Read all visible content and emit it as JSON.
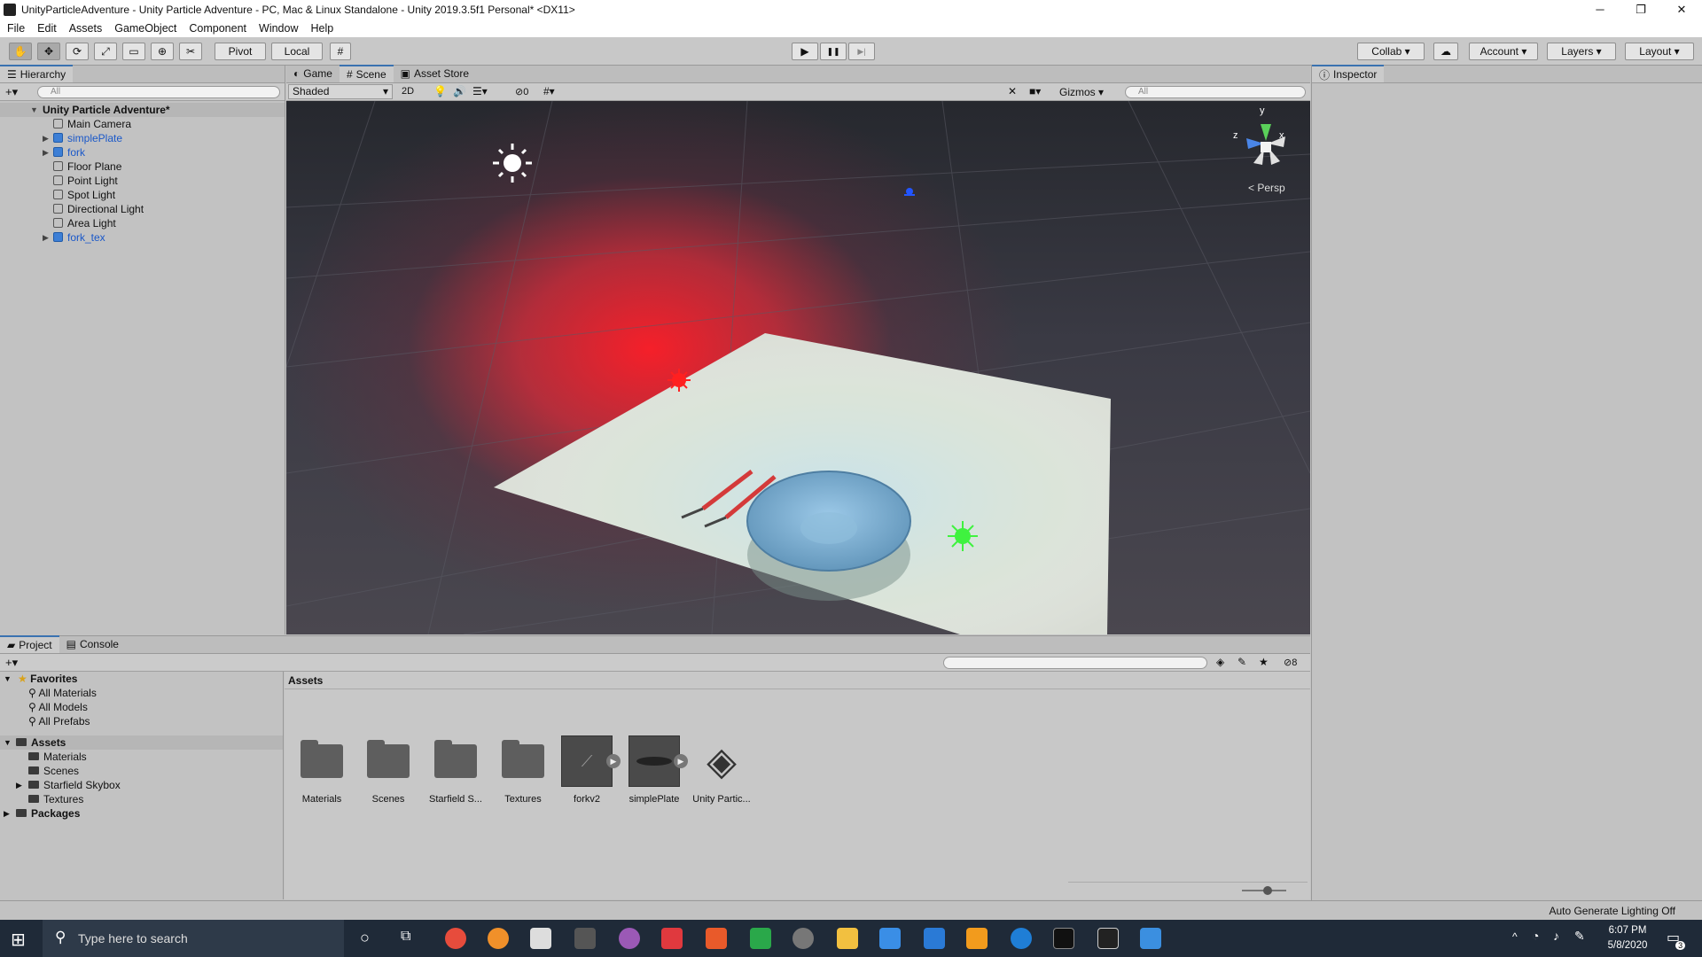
{
  "window": {
    "title": "UnityParticleAdventure - Unity Particle Adventure - PC, Mac & Linux Standalone - Unity 2019.3.5f1 Personal* <DX11>",
    "min": "─",
    "restore": "❐",
    "close": "✕"
  },
  "menu": [
    "File",
    "Edit",
    "Assets",
    "GameObject",
    "Component",
    "Window",
    "Help"
  ],
  "toolbar": {
    "pivot": "Pivot",
    "local": "Local",
    "collab": "Collab ▾",
    "account": "Account",
    "layers": "Layers",
    "layout": "Layout",
    "play": "▶",
    "pause": "❚❚",
    "step": "▶|"
  },
  "hierarchy": {
    "tab": "Hierarchy",
    "search_placeholder": "All",
    "scene": "Unity Particle Adventure*",
    "items": [
      {
        "label": "Main Camera",
        "prefab": false,
        "expandable": false
      },
      {
        "label": "simplePlate",
        "prefab": true,
        "expandable": true
      },
      {
        "label": "fork",
        "prefab": true,
        "expandable": true
      },
      {
        "label": "Floor Plane",
        "prefab": false,
        "expandable": false
      },
      {
        "label": "Point Light",
        "prefab": false,
        "expandable": false
      },
      {
        "label": "Spot Light",
        "prefab": false,
        "expandable": false
      },
      {
        "label": "Directional Light",
        "prefab": false,
        "expandable": false
      },
      {
        "label": "Area Light",
        "prefab": false,
        "expandable": false
      },
      {
        "label": "fork_tex",
        "prefab": true,
        "expandable": true
      }
    ]
  },
  "scene": {
    "tabs": [
      "Game",
      "Scene",
      "Asset Store"
    ],
    "shading": "Shaded",
    "mode2d": "2D",
    "hidden_count": "0",
    "gizmos": "Gizmos",
    "search_placeholder": "All",
    "persp": "Persp",
    "axis_x": "x",
    "axis_y": "y",
    "axis_z": "z"
  },
  "inspector": {
    "tab": "Inspector"
  },
  "project": {
    "tabs": [
      "Project",
      "Console"
    ],
    "favorites": {
      "label": "Favorites",
      "items": [
        "All Materials",
        "All Models",
        "All Prefabs"
      ]
    },
    "assets_root": "Assets",
    "asset_folders": [
      "Materials",
      "Scenes",
      "Starfield Skybox",
      "Textures"
    ],
    "packages": "Packages",
    "breadcrumb": "Assets",
    "hidden_count": "8",
    "grid": [
      {
        "label": "Materials",
        "kind": "folder"
      },
      {
        "label": "Scenes",
        "kind": "folder"
      },
      {
        "label": "Starfield S...",
        "kind": "folder"
      },
      {
        "label": "Textures",
        "kind": "folder"
      },
      {
        "label": "forkv2",
        "kind": "model"
      },
      {
        "label": "simplePlate",
        "kind": "model"
      },
      {
        "label": "Unity Partic...",
        "kind": "unity"
      }
    ]
  },
  "status": {
    "lighting": "Auto Generate Lighting Off"
  },
  "taskbar": {
    "search_placeholder": "Type here to search",
    "time": "6:07 PM",
    "date": "5/8/2020",
    "notif_count": "3"
  }
}
